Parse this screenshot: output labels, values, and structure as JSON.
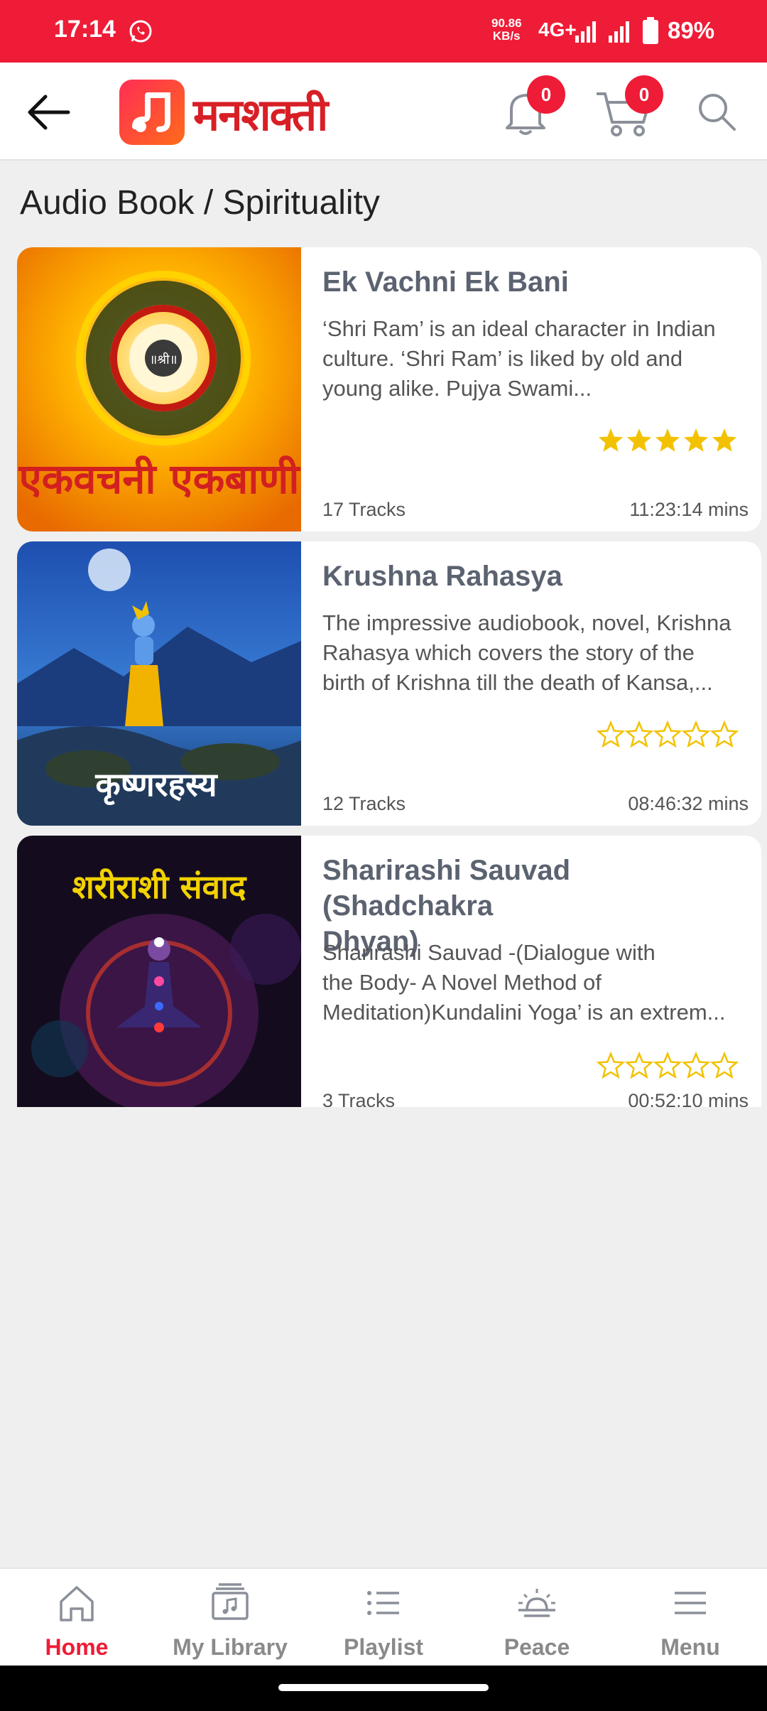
{
  "status_bar": {
    "time": "17:14",
    "speed_top": "90.86",
    "speed_bottom": "KB/s",
    "network": "4G+",
    "battery": "89%"
  },
  "header": {
    "logo_text": "मनशक्ती",
    "notification_count": "0",
    "cart_count": "0"
  },
  "page": {
    "title": "Audio Book / Spirituality"
  },
  "books": [
    {
      "title": "Ek Vachni Ek Bani",
      "cover_text": "एकवचनी एकबाणी",
      "description_lines": [
        "‘Shri Ram’ is an ideal character in Indian",
        "culture. ‘Shri Ram’ is liked by old and",
        "young alike. Pujya Swami..."
      ],
      "rating": 5,
      "tracks": "17 Tracks",
      "duration": "11:23:14 mins"
    },
    {
      "title": "Krushna Rahasya",
      "cover_text": "कृष्णरहस्य",
      "description_lines": [
        "The impressive audiobook, novel, Krishna",
        "Rahasya which covers the story of the",
        "birth of Krishna till the death of Kansa,..."
      ],
      "rating": 0,
      "tracks": "12 Tracks",
      "duration": "08:46:32 mins"
    },
    {
      "title_lines": [
        "Sharirashi Sauvad (Shadchakra",
        "Dhyan)"
      ],
      "cover_text": "शरीराशी संवाद",
      "description_lines": [
        "Sharirashi Sauvad -(Dialogue with",
        "the Body- A Novel Method of",
        "Meditation)Kundalini Yoga’ is an extrem..."
      ],
      "rating": 0,
      "tracks": "3 Tracks",
      "duration": "00:52:10 mins"
    }
  ],
  "bottom_nav": [
    {
      "label": "Home",
      "icon": "home-icon",
      "active": true
    },
    {
      "label": "My Library",
      "icon": "library-icon",
      "active": false
    },
    {
      "label": "Playlist",
      "icon": "playlist-icon",
      "active": false
    },
    {
      "label": "Peace",
      "icon": "sunrise-icon",
      "active": false
    },
    {
      "label": "Menu",
      "icon": "menu-icon",
      "active": false
    }
  ],
  "colors": {
    "brand_red": "#ee1c36",
    "star_gold": "#f2c200",
    "title_gray": "#5b6270"
  }
}
